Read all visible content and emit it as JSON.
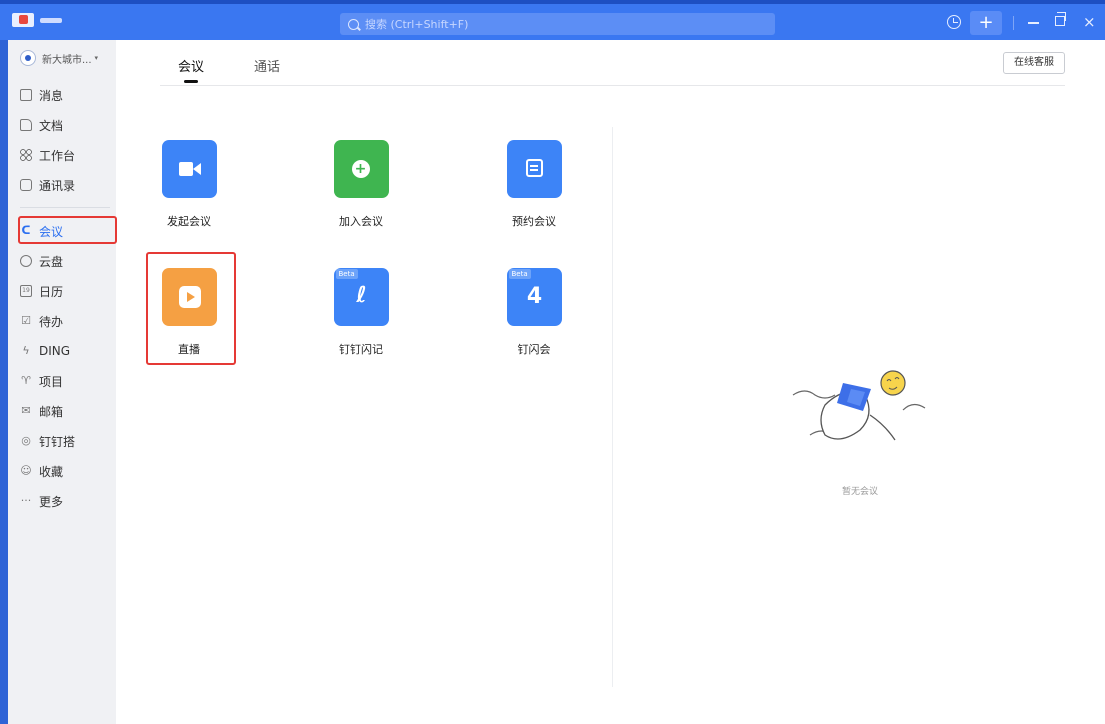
{
  "titlebar": {
    "search_placeholder": "搜索 (Ctrl+Shift+F)",
    "add_label": "+",
    "close_label": "×"
  },
  "sidebar": {
    "org_name": "新大城市...",
    "org_caret": "▾",
    "items": [
      {
        "label": "消息",
        "icon": "message-icon"
      },
      {
        "label": "文档",
        "icon": "document-icon"
      },
      {
        "label": "工作台",
        "icon": "workbench-icon"
      },
      {
        "label": "通讯录",
        "icon": "contacts-icon"
      },
      {
        "label": "会议",
        "icon": "meeting-icon",
        "active": true
      },
      {
        "label": "云盘",
        "icon": "cloud-icon"
      },
      {
        "label": "日历",
        "icon": "calendar-icon"
      },
      {
        "label": "待办",
        "icon": "todo-icon"
      },
      {
        "label": "DING",
        "icon": "ding-icon"
      },
      {
        "label": "项目",
        "icon": "project-icon"
      },
      {
        "label": "邮箱",
        "icon": "mail-icon"
      },
      {
        "label": "钉钉搭",
        "icon": "dingda-icon"
      },
      {
        "label": "收藏",
        "icon": "favorite-icon"
      },
      {
        "label": "更多",
        "icon": "more-icon"
      }
    ],
    "icon_glyphs": {
      "calendar": "19",
      "todo": "☑",
      "ding": "ϟ",
      "project": "♈",
      "mail": "✉",
      "dingda": "◎",
      "favorite": "☺",
      "more": "···"
    }
  },
  "tabs": [
    {
      "label": "会议",
      "active": true
    },
    {
      "label": "通话",
      "active": false
    }
  ],
  "customer_service_label": "在线客服",
  "tiles": [
    {
      "label": "发起会议",
      "icon": "video-camera-icon",
      "color": "#3d84f7"
    },
    {
      "label": "加入会议",
      "icon": "join-plus-icon",
      "color": "#3fb550"
    },
    {
      "label": "预约会议",
      "icon": "calendar-schedule-icon",
      "color": "#3d84f7"
    },
    {
      "label": "直播",
      "icon": "live-tv-icon",
      "color": "#f5a043"
    },
    {
      "label": "钉钉闪记",
      "icon": "flash-note-icon",
      "color": "#3d84f7",
      "badge": "Beta",
      "glyph": "ℓ"
    },
    {
      "label": "钉闪会",
      "icon": "flash-meeting-icon",
      "color": "#3d84f7",
      "badge": "Beta",
      "glyph": "4"
    }
  ],
  "empty_state": {
    "text": "暂无会议"
  },
  "colors": {
    "titlebar": "#3a77f1",
    "accent": "#2b6ff0",
    "highlight": "#e53935"
  }
}
